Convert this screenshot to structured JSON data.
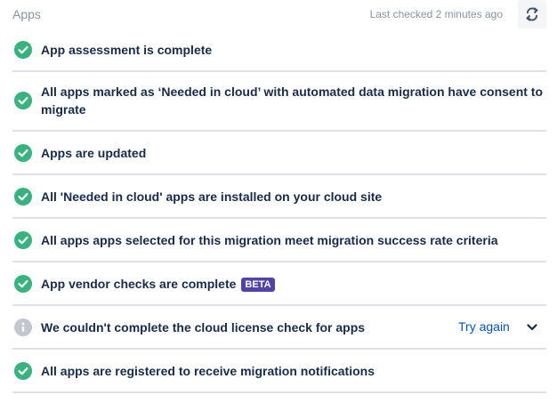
{
  "header": {
    "title": "Apps",
    "last_checked": "Last checked 2 minutes ago",
    "refresh_icon": "refresh-icon"
  },
  "checks": [
    {
      "status": "success",
      "icon": "check-circle-icon",
      "label": "App assessment is complete"
    },
    {
      "status": "success",
      "icon": "check-circle-icon",
      "label": "All apps marked as ‘Needed in cloud’ with automated data migration have consent to migrate"
    },
    {
      "status": "success",
      "icon": "check-circle-icon",
      "label": "Apps are updated"
    },
    {
      "status": "success",
      "icon": "check-circle-icon",
      "label": "All 'Needed in cloud' apps are installed on your cloud site"
    },
    {
      "status": "success",
      "icon": "check-circle-icon",
      "label": "All apps apps selected for this migration meet migration success rate criteria"
    },
    {
      "status": "success",
      "icon": "check-circle-icon",
      "label": "App vendor checks are complete",
      "badge": "BETA"
    },
    {
      "status": "info",
      "icon": "info-circle-icon",
      "label": "We couldn't complete the cloud license check for apps",
      "action": "Try again",
      "expand_icon": "chevron-down-icon"
    },
    {
      "status": "success",
      "icon": "check-circle-icon",
      "label": "All apps are registered to receive migration notifications"
    }
  ],
  "colors": {
    "success": "#36b37e",
    "info": "#c1c7d0",
    "badge": "#5243aa",
    "link": "#0052cc",
    "text": "#172b4d",
    "muted": "#8993a4",
    "divider": "#dfe1e6"
  }
}
